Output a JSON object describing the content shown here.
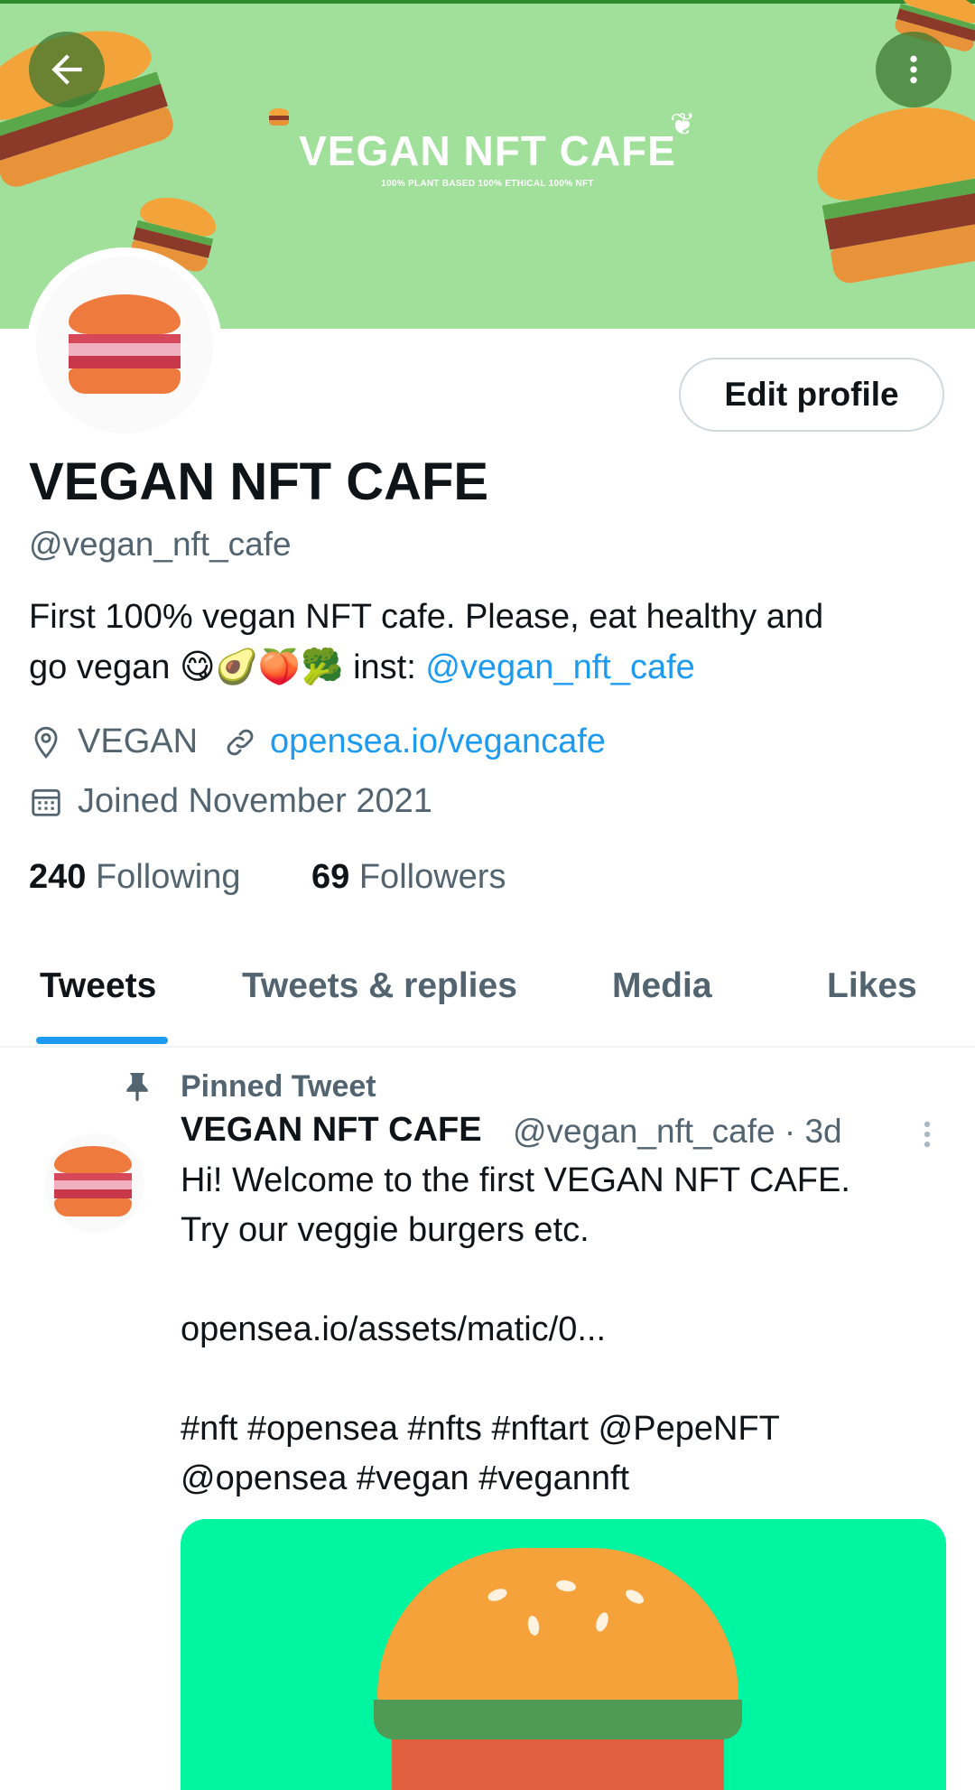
{
  "banner": {
    "title": "VEGAN NFT CAFE",
    "subtitle": "100% PLANT BASED 100% ETHICAL 100% NFT",
    "background_color": "#a0e09b"
  },
  "profile": {
    "edit_button_label": "Edit profile",
    "name": "VEGAN NFT CAFE",
    "handle": "@vegan_nft_cafe",
    "bio_line1": "First 100% vegan NFT cafe. Please, eat healthy and",
    "bio_line2_prefix": "go vegan",
    "bio_emojis": "😋🥑🍑🥦",
    "bio_inst_label": "inst:",
    "bio_inst_handle": "@vegan_nft_cafe",
    "location": "VEGAN",
    "website": "opensea.io/vegancafe",
    "joined": "Joined November 2021",
    "following_count": "240",
    "following_label": "Following",
    "followers_count": "69",
    "followers_label": "Followers"
  },
  "tabs": [
    {
      "label": "Tweets",
      "active": true
    },
    {
      "label": "Tweets & replies",
      "active": false
    },
    {
      "label": "Media",
      "active": false
    },
    {
      "label": "Likes",
      "active": false
    }
  ],
  "tweet": {
    "pinned_label": "Pinned Tweet",
    "author_name": "VEGAN NFT CAFE",
    "author_handle_time": "@vegan_nft_cafe · 3d",
    "text_line1": "Hi! Welcome to the first VEGAN NFT CAFE.",
    "text_line2": "Try our veggie burgers etc.",
    "link": "opensea.io/assets/matic/0...",
    "tags_line1": "#nft #opensea #nfts #nftart @PepeNFT",
    "tags_line2": "@opensea #vegan #vegannft"
  },
  "colors": {
    "accent": "#1d9bf0",
    "text": "#0f1419",
    "secondary": "#536471",
    "media_background": "#00f5a0"
  },
  "icons": [
    "back-arrow-icon",
    "more-vertical-icon",
    "location-pin-icon",
    "link-icon",
    "calendar-icon",
    "pin-icon",
    "more-icon"
  ]
}
